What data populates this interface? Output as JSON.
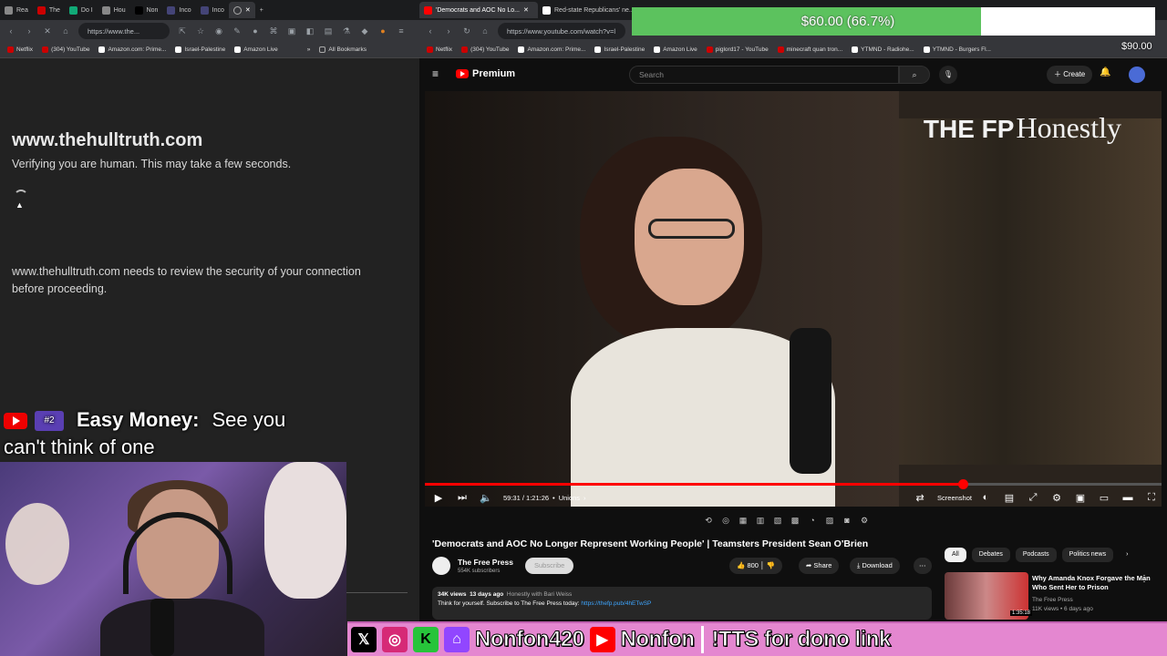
{
  "left_browser": {
    "tabs": [
      "Rea",
      "The",
      "Do I",
      "Hou",
      "Non",
      "Inco",
      "Inco"
    ],
    "url": "https://www.the...",
    "bookmarks": [
      "Netflix",
      "(304) YouTube",
      "Amazon.com: Prime...",
      "Israel-Palestine",
      "Amazon Live"
    ],
    "all_bookmarks": "All Bookmarks"
  },
  "cloudflare": {
    "host": "www.thehulltruth.com",
    "verifying": "Verifying you are human. This may take a few seconds.",
    "note": "www.thehulltruth.com needs to review the security of your connection before proceeding."
  },
  "chat": {
    "rank": "#2",
    "name": "Easy Money:",
    "message_line1": "See you",
    "message_line2": "can't think of one"
  },
  "right_browser": {
    "tabs": [
      "'Democrats and AOC No Lo...",
      "Red-state Republicans' ne..."
    ],
    "url": "https://www.youtube.com/watch?v=l",
    "bookmarks": [
      "Netflix",
      "(304) YouTube",
      "Amazon.com: Prime...",
      "Israel-Palestine",
      "Amazon Live",
      "piglord17 - YouTube",
      "minecraft quan tron...",
      "YTMND - Radiohe...",
      "YTMND - Burgers Fl..."
    ]
  },
  "youtube": {
    "logo": "Premium",
    "search_placeholder": "Search",
    "create": "Create",
    "brand_overlay_fp": "THE FP",
    "brand_overlay": "Honestly",
    "time": "59:31 / 1:21:26",
    "chapter": "Unions",
    "screenshot_label": "Screenshot",
    "progress_fraction": 0.73,
    "title": "'Democrats and AOC No Longer Represent Working People' | Teamsters President Sean O'Brien",
    "channel": "The Free Press",
    "subscribers": "554K subscribers",
    "subscribe": "Subscribe",
    "likes": "800",
    "share": "Share",
    "download": "Download",
    "views": "34K views",
    "age": "13 days ago",
    "playlist": "Honestly with Bari Weiss",
    "desc_text": "Think for yourself. Subscribe to The Free Press today:",
    "desc_link": "https://thefp.pub/4hETwSP",
    "chips": [
      "All",
      "Debates",
      "Podcasts",
      "Politics news"
    ],
    "rec_title": "Why Amanda Knox Forgave the Man Who Sent Her to Prison",
    "rec_channel": "The Free Press",
    "rec_meta": "11K views • 6 days ago",
    "rec_duration": "1:35:18"
  },
  "donation": {
    "current": "$60.00 (66.7%)",
    "goal": "$90.00",
    "fraction": 0.667
  },
  "social": {
    "handle1": "Nonfon420",
    "handle2": "Nonfon",
    "tts": "!TTS for dono link"
  }
}
